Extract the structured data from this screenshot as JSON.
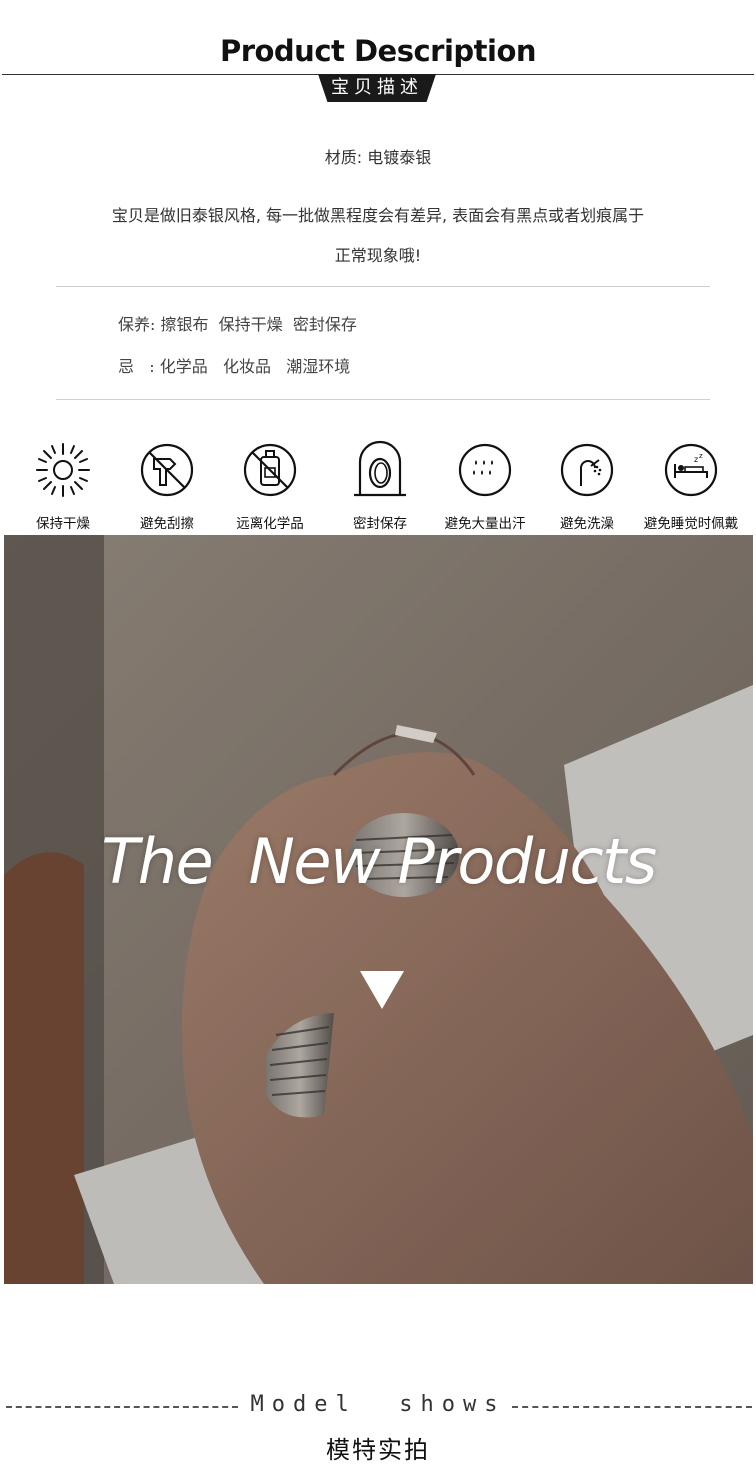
{
  "header": {
    "title": "Product Description",
    "tag": "宝贝描述"
  },
  "description": {
    "material": "材质: 电镀泰银",
    "note_line1": "宝贝是做旧泰银风格, 每一批做黑程度会有差异, 表面会有黑点或者划痕属于",
    "note_line2": "正常现象哦!"
  },
  "care": {
    "maintain": "保养: 擦银布  保持干燥  密封保存",
    "avoid": "忌   : 化学品   化妆品   潮湿环境"
  },
  "icons": [
    {
      "name": "sun-icon",
      "label": "保持干燥"
    },
    {
      "name": "no-scratch-icon",
      "label": "避免刮擦"
    },
    {
      "name": "no-chemicals-icon",
      "label": "远离化学品"
    },
    {
      "name": "sealed-ring-icon",
      "label": "密封保存"
    },
    {
      "name": "sweat-drops-icon",
      "label": "避免大量出汗"
    },
    {
      "name": "shower-icon",
      "label": "避免洗澡"
    },
    {
      "name": "sleep-icon",
      "label": "避免睡觉时佩戴"
    }
  ],
  "photo": {
    "title": "The  New Products"
  },
  "model_shows": {
    "en": "Model  shows",
    "cn": "模特实拍"
  },
  "colors": {
    "dark": "#1a1a1a",
    "sweater": "#8f8478",
    "skin": "#a07c6a"
  }
}
